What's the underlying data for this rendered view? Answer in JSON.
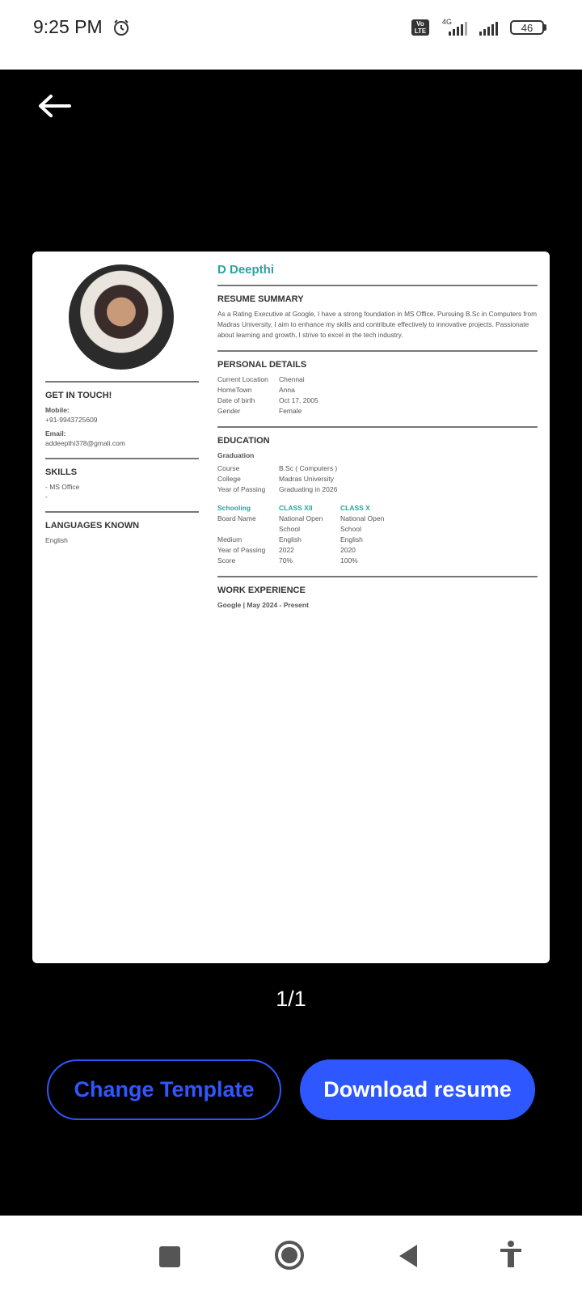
{
  "status_bar": {
    "time": "9:25 PM",
    "network": "4G",
    "battery": "46"
  },
  "resume": {
    "name": "D Deepthi",
    "get_in_touch": {
      "title": "GET IN TOUCH!",
      "mobile_label": "Mobile:",
      "mobile": "+91-9943725609",
      "email_label": "Email:",
      "email": "addeepthi378@gmali.com"
    },
    "skills": {
      "title": "SKILLS",
      "items": [
        "- MS Office",
        "-"
      ]
    },
    "languages": {
      "title": "LANGUAGES KNOWN",
      "value": "English"
    },
    "summary": {
      "title": "RESUME SUMMARY",
      "text": "As a Rating Executive at Google, I have a strong foundation in MS Office. Pursuing B.Sc in Computers from Madras University, I aim to enhance my skills and contribute effectively to innovative projects. Passionate about learning and growth, I strive to excel in the tech industry."
    },
    "personal": {
      "title": "PERSONAL DETAILS",
      "rows": [
        {
          "k": "Current Location",
          "v": "Chennai"
        },
        {
          "k": "HomeTown",
          "v": "Anna"
        },
        {
          "k": "Date of birth",
          "v": "Oct 17, 2005"
        },
        {
          "k": "Gender",
          "v": "Female"
        }
      ]
    },
    "education": {
      "title": "EDUCATION",
      "graduation_label": "Graduation",
      "graduation": [
        {
          "k": "Course",
          "v": "B.Sc  ( Computers )"
        },
        {
          "k": "College",
          "v": "Madras University"
        },
        {
          "k": "Year of Passing",
          "v": "Graduating in 2026"
        }
      ],
      "schooling_label": "Schooling",
      "class12_label": "CLASS XII",
      "class10_label": "CLASS X",
      "schooling": [
        {
          "k": "Board Name",
          "a": "National Open",
          "b": "National Open"
        },
        {
          "k": "",
          "a": "School",
          "b": "School"
        },
        {
          "k": "Medium",
          "a": "English",
          "b": "English"
        },
        {
          "k": "Year of Passing",
          "a": "2022",
          "b": "2020"
        },
        {
          "k": "Score",
          "a": "70%",
          "b": "100%"
        }
      ]
    },
    "work": {
      "title": "WORK EXPERIENCE",
      "entry": "Google | May 2024 - Present"
    }
  },
  "page_indicator": "1/1",
  "buttons": {
    "change": "Change Template",
    "download": "Download resume"
  }
}
